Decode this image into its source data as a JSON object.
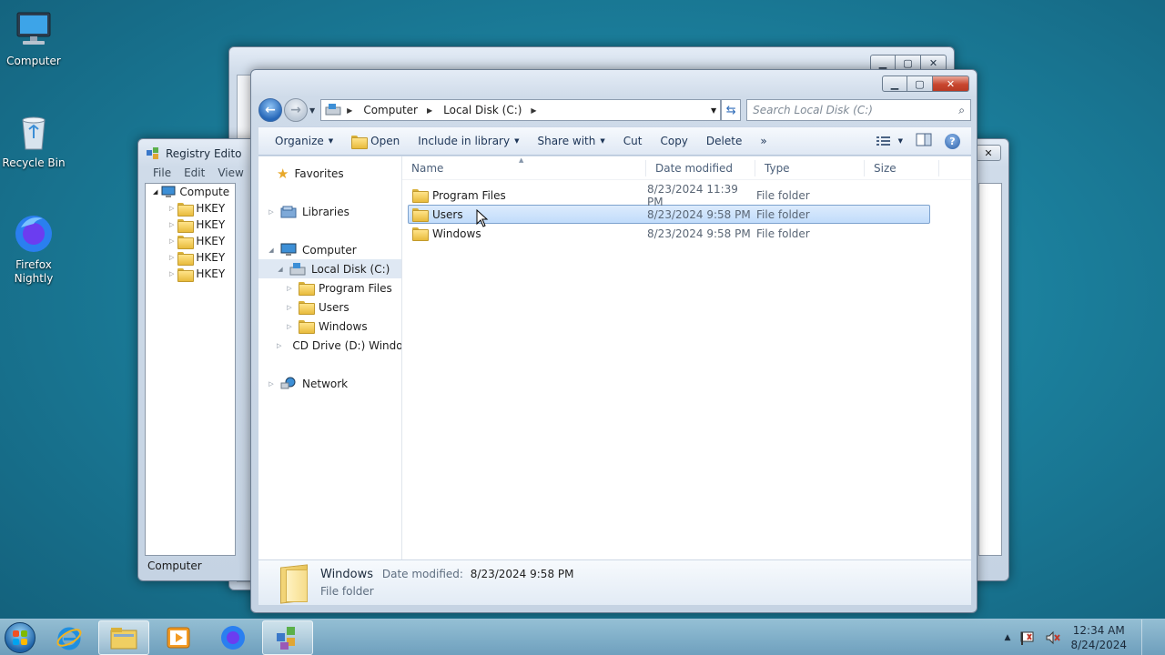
{
  "desktop": {
    "icons": [
      {
        "label": "Computer"
      },
      {
        "label": "Recycle Bin"
      },
      {
        "label": "Firefox Nightly"
      }
    ]
  },
  "regedit": {
    "title": "Registry Edito",
    "menu": [
      "File",
      "Edit",
      "View"
    ],
    "root": "Compute",
    "keys": [
      "HKEY",
      "HKEY",
      "HKEY",
      "HKEY",
      "HKEY"
    ],
    "status": "Computer"
  },
  "explorer": {
    "breadcrumb": [
      "Computer",
      "Local Disk (C:)"
    ],
    "search_placeholder": "Search Local Disk (C:)",
    "toolbar": {
      "organize": "Organize",
      "open": "Open",
      "include": "Include in library",
      "share": "Share with",
      "cut": "Cut",
      "copy": "Copy",
      "delete": "Delete",
      "more": "»"
    },
    "nav": {
      "favorites": "Favorites",
      "libraries": "Libraries",
      "computer": "Computer",
      "local_disk": "Local Disk (C:)",
      "children": [
        "Program Files",
        "Users",
        "Windows"
      ],
      "cd_drive": "CD Drive (D:) Windo",
      "network": "Network"
    },
    "columns": {
      "name": "Name",
      "date": "Date modified",
      "type": "Type",
      "size": "Size"
    },
    "files": [
      {
        "name": "Program Files",
        "date": "8/23/2024 11:39 PM",
        "type": "File folder"
      },
      {
        "name": "Users",
        "date": "8/23/2024 9:58 PM",
        "type": "File folder"
      },
      {
        "name": "Windows",
        "date": "8/23/2024 9:58 PM",
        "type": "File folder"
      }
    ],
    "details": {
      "name": "Windows",
      "date_label": "Date modified:",
      "date_value": "8/23/2024 9:58 PM",
      "type": "File folder"
    }
  },
  "taskbar": {
    "time": "12:34 AM",
    "date": "8/24/2024"
  },
  "colors": {
    "accent": "#2667b8",
    "selection": "#c1dcfb",
    "close": "#c8462f"
  }
}
